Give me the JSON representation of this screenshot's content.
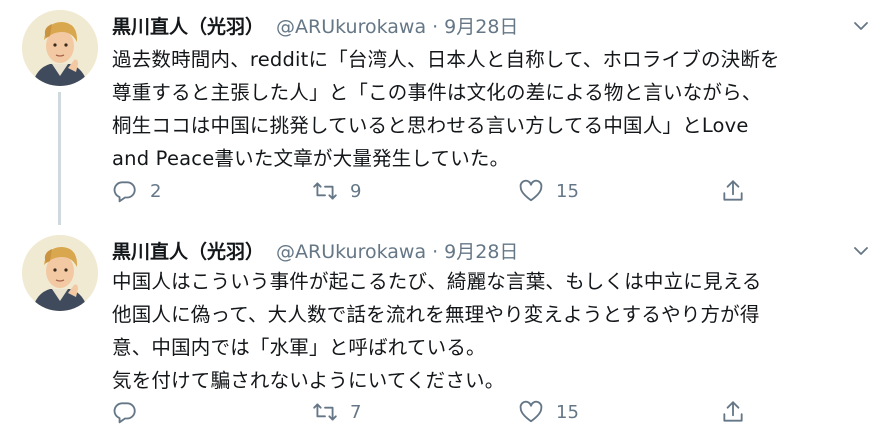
{
  "tweets": [
    {
      "display_name": "黒川直人（光羽）",
      "handle": "@ARUkurokawa",
      "separator": "·",
      "date": "9月28日",
      "text": "過去数時間内、redditに「台湾人、日本人と自称して、ホロライブの決断を\n尊重すると主張した人」と「この事件は文化の差による物と言いながら、\n桐生ココは中国に挑発していると思わせる言い方してる中国人」とLove\nand Peace書いた文章が大量発生していた。",
      "replies": "2",
      "retweets": "9",
      "likes": "15",
      "icons": {
        "reply": "reply-icon",
        "retweet": "retweet-icon",
        "like": "heart-icon",
        "share": "share-icon",
        "more": "chevron-down-icon"
      }
    },
    {
      "display_name": "黒川直人（光羽）",
      "handle": "@ARUkurokawa",
      "separator": "·",
      "date": "9月28日",
      "text": "中国人はこういう事件が起こるたび、綺麗な言葉、もしくは中立に見える\n他国人に偽って、大人数で話を流れを無理やり変えようとするやり方が得\n意、中国内では「水軍」と呼ばれている。\n気を付けて騙されないようにいてください。",
      "replies": "",
      "retweets": "7",
      "likes": "15",
      "icons": {
        "reply": "reply-icon",
        "retweet": "retweet-icon",
        "like": "heart-icon",
        "share": "share-icon",
        "more": "chevron-down-icon"
      }
    }
  ],
  "colors": {
    "text": "#14171a",
    "muted": "#657786",
    "thread_line": "#cfd9de"
  }
}
